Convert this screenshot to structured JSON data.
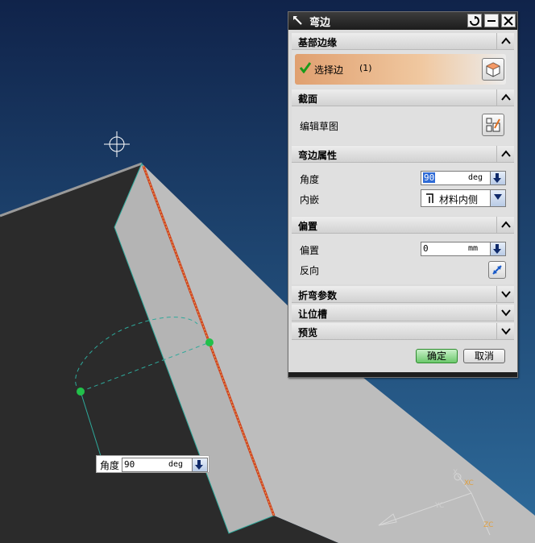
{
  "dialog": {
    "title": "弯边",
    "sections": {
      "base_edge": {
        "title": "基部边缘",
        "select_label": "选择边",
        "select_count": "(1)"
      },
      "section": {
        "title": "截面",
        "edit_sketch": "编辑草图"
      },
      "props": {
        "title": "弯边属性",
        "angle_label": "角度",
        "angle_value": "90",
        "angle_unit": "deg",
        "inset_label": "内嵌",
        "inset_value": "材料内侧"
      },
      "offset": {
        "title": "偏置",
        "offset_label": "偏置",
        "offset_value": "0",
        "offset_unit": "mm",
        "reverse_label": "反向"
      },
      "bend_params": {
        "title": "折弯参数"
      },
      "relief": {
        "title": "让位槽"
      },
      "preview": {
        "title": "预览"
      }
    },
    "ok_label": "确定",
    "cancel_label": "取消"
  },
  "screen_input": {
    "label": "角度",
    "value": "90",
    "unit": "deg"
  },
  "triad": {
    "x": "X",
    "xc": "XC",
    "yc": "YC",
    "zc": "ZC"
  },
  "colors": {
    "background_top": "#12264e",
    "background_bottom": "#2d6a9a",
    "accent_select": "#e0a070",
    "ok_button": "#6cc86c"
  }
}
